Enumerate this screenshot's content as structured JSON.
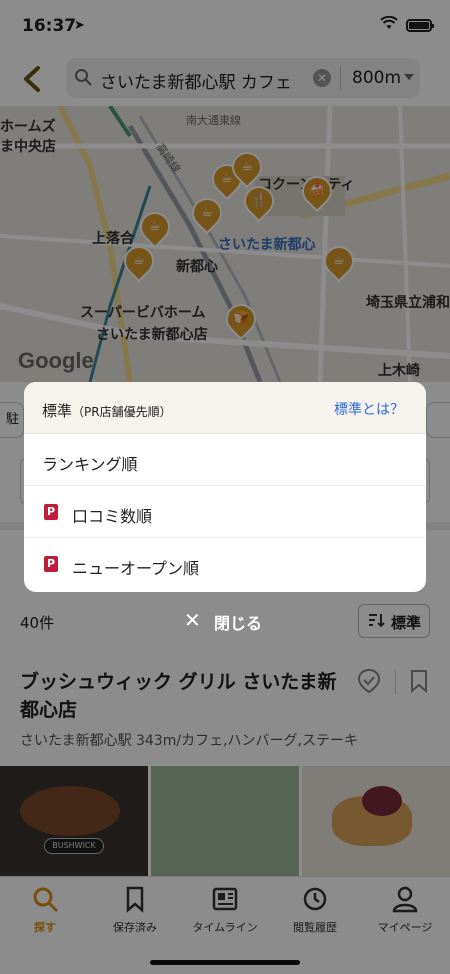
{
  "status": {
    "time": "16:37"
  },
  "search": {
    "query": "さいたま新都心駅 カフェ",
    "distance": "800m"
  },
  "map": {
    "labels": {
      "homes": "ホームズ",
      "store_central": "ま中央店",
      "nandai": "南大通東線",
      "takasaki": "高崎線",
      "kamiochiai": "上落合",
      "shintoshin_area": "新都心",
      "station": "さいたま新都心",
      "cocoon_city": "コクーンシティ",
      "supervivahome": "スーパービバホーム",
      "supervivahome_2": "さいたま新都心店",
      "prefecture": "埼玉県立浦和",
      "kamikizaki": "上木崎"
    },
    "brand": "Google"
  },
  "background": {
    "chip_left": "駐",
    "result_count": "40件",
    "sort_button_label": "標準",
    "restaurant": {
      "name": "ブッシュウィック グリル さいたま新都心店",
      "meta": "さいたま新都心駅 343m/カフェ,ハンバーグ,ステーキ",
      "photo_sign": "BUSHWICK"
    }
  },
  "sort_sheet": {
    "title": "標準",
    "title_note": "（PR店舗優先順）",
    "help_link": "標準とは？",
    "items": [
      {
        "label": "ランキング順",
        "pr": false
      },
      {
        "label": "口コミ数順",
        "pr": true
      },
      {
        "label": "ニューオープン順",
        "pr": true
      }
    ]
  },
  "close_button": {
    "label": "閉じる"
  },
  "tabbar": {
    "tabs": [
      {
        "label": "探す",
        "icon": "search-icon",
        "active": true
      },
      {
        "label": "保存済み",
        "icon": "bookmark-icon",
        "active": false
      },
      {
        "label": "タイムライン",
        "icon": "timeline-icon",
        "active": false
      },
      {
        "label": "閲覧履歴",
        "icon": "history-icon",
        "active": false
      },
      {
        "label": "マイページ",
        "icon": "person-icon",
        "active": false
      }
    ]
  },
  "colors": {
    "accent": "#d98f13",
    "link": "#2d6bd8",
    "pr_badge": "#c01c3b",
    "map_pin": "#d99a2b"
  }
}
